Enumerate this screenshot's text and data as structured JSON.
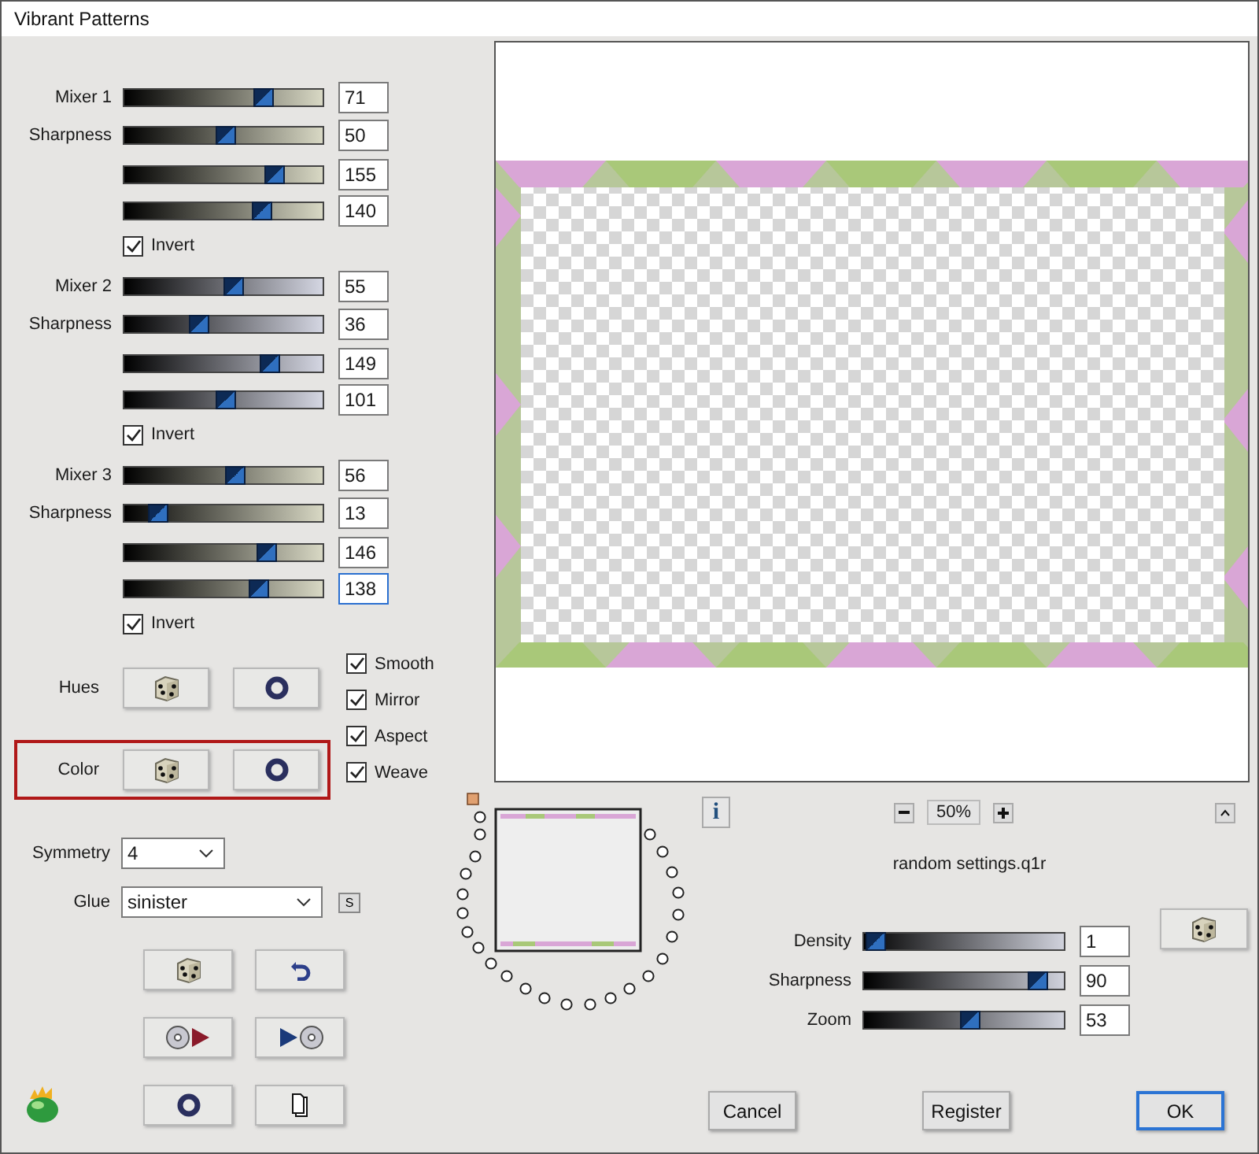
{
  "window": {
    "title": "Vibrant Patterns"
  },
  "mixers": [
    {
      "sliders": [
        {
          "label": "Mixer 1",
          "level": 0.71,
          "value": "71"
        },
        {
          "label": "Sharpness",
          "level": 0.5,
          "value": "50"
        },
        {
          "level": 0.775,
          "value": "155"
        },
        {
          "level": 0.7,
          "value": "140"
        }
      ],
      "invert": {
        "label": "Invert",
        "checked": true
      }
    },
    {
      "sliders": [
        {
          "label": "Mixer 2",
          "level": 0.55,
          "value": "55"
        },
        {
          "label": "Sharpness",
          "level": 0.36,
          "value": "36"
        },
        {
          "level": 0.745,
          "value": "149"
        },
        {
          "level": 0.505,
          "value": "101"
        }
      ],
      "invert": {
        "label": "Invert",
        "checked": true
      }
    },
    {
      "sliders": [
        {
          "label": "Mixer 3",
          "level": 0.56,
          "value": "56"
        },
        {
          "label": "Sharpness",
          "level": 0.13,
          "value": "13"
        },
        {
          "level": 0.73,
          "value": "146"
        },
        {
          "level": 0.69,
          "value": "138",
          "focused": true
        }
      ],
      "invert": {
        "label": "Invert",
        "checked": true
      }
    }
  ],
  "randomizers": [
    {
      "label": "Hues",
      "highlighted": false
    },
    {
      "label": "Color",
      "highlighted": true
    }
  ],
  "options": [
    {
      "label": "Smooth",
      "checked": true
    },
    {
      "label": "Mirror",
      "checked": true
    },
    {
      "label": "Aspect",
      "checked": true
    },
    {
      "label": "Weave",
      "checked": true
    }
  ],
  "symmetry": {
    "label": "Symmetry",
    "value": "4"
  },
  "glue": {
    "label": "Glue",
    "value": "sinister",
    "button": "S"
  },
  "info": {
    "label": "i"
  },
  "zoom": {
    "value": "50%"
  },
  "file_name": "random settings.q1r",
  "render_sliders": [
    {
      "label": "Density",
      "level": 0.01,
      "value": "1"
    },
    {
      "label": "Sharpness",
      "level": 0.9,
      "value": "90"
    },
    {
      "label": "Zoom",
      "level": 0.53,
      "value": "53"
    }
  ],
  "buttons": [
    {
      "label": "Cancel",
      "default": false
    },
    {
      "label": "Register",
      "default": false
    },
    {
      "label": "OK",
      "default": true
    }
  ]
}
